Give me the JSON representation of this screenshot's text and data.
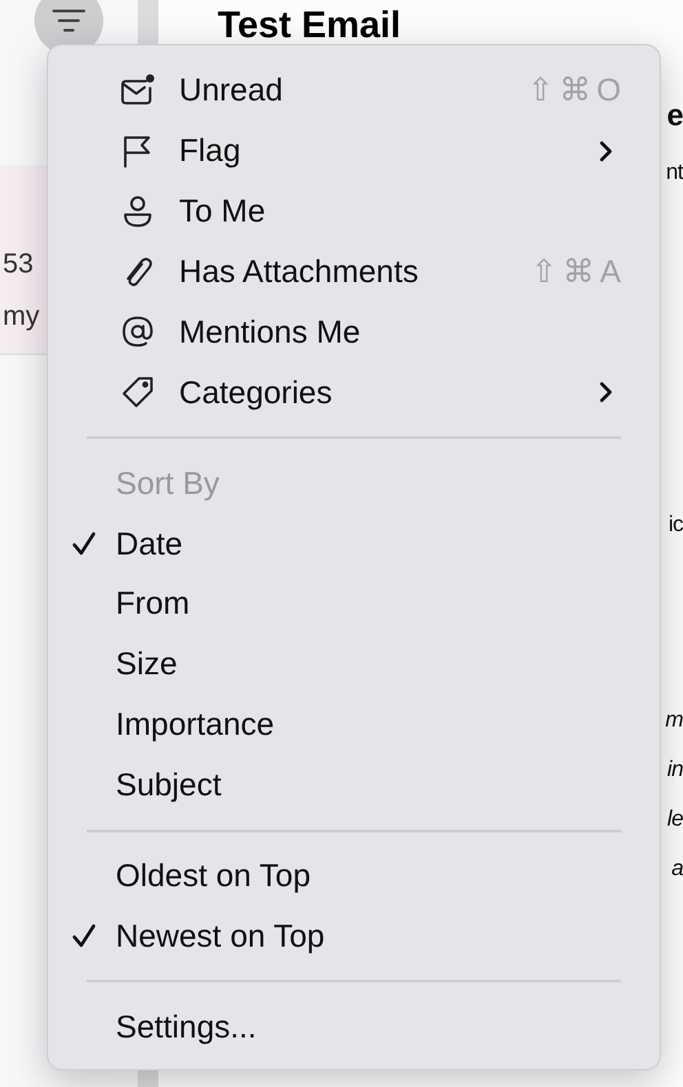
{
  "message": {
    "title": "Test Email"
  },
  "message_list": [
    {
      "line_1": "53",
      "line_2": "my"
    }
  ],
  "preview_fragments": [
    {
      "text": "e",
      "kind": "heading"
    },
    {
      "text": "nt",
      "kind": "plain"
    },
    {
      "text": "ic",
      "kind": "plain"
    },
    {
      "text": "m",
      "kind": "italic"
    },
    {
      "text": "in",
      "kind": "italic"
    },
    {
      "text": "le",
      "kind": "italic"
    },
    {
      "text": "a",
      "kind": "italic"
    }
  ],
  "menu": {
    "sections": [
      {
        "items": [
          {
            "label": "Unread",
            "shortcut": "⇧⌘O",
            "submenu": false
          },
          {
            "label": "Flag",
            "submenu": true
          },
          {
            "label": "To Me",
            "submenu": false
          },
          {
            "label": "Has Attachments",
            "shortcut": "⇧⌘A",
            "submenu": false
          },
          {
            "label": "Mentions Me",
            "submenu": false
          },
          {
            "label": "Categories",
            "submenu": true
          }
        ]
      },
      {
        "header": "Sort By",
        "items": [
          {
            "label": "Date",
            "checked": true
          },
          {
            "label": "From",
            "checked": false
          },
          {
            "label": "Size",
            "checked": false
          },
          {
            "label": "Importance",
            "checked": false
          },
          {
            "label": "Subject",
            "checked": false
          }
        ]
      },
      {
        "items": [
          {
            "label": "Oldest on Top",
            "checked": false
          },
          {
            "label": "Newest on Top",
            "checked": true
          }
        ]
      },
      {
        "items": [
          {
            "label": "Settings..."
          }
        ]
      }
    ]
  }
}
